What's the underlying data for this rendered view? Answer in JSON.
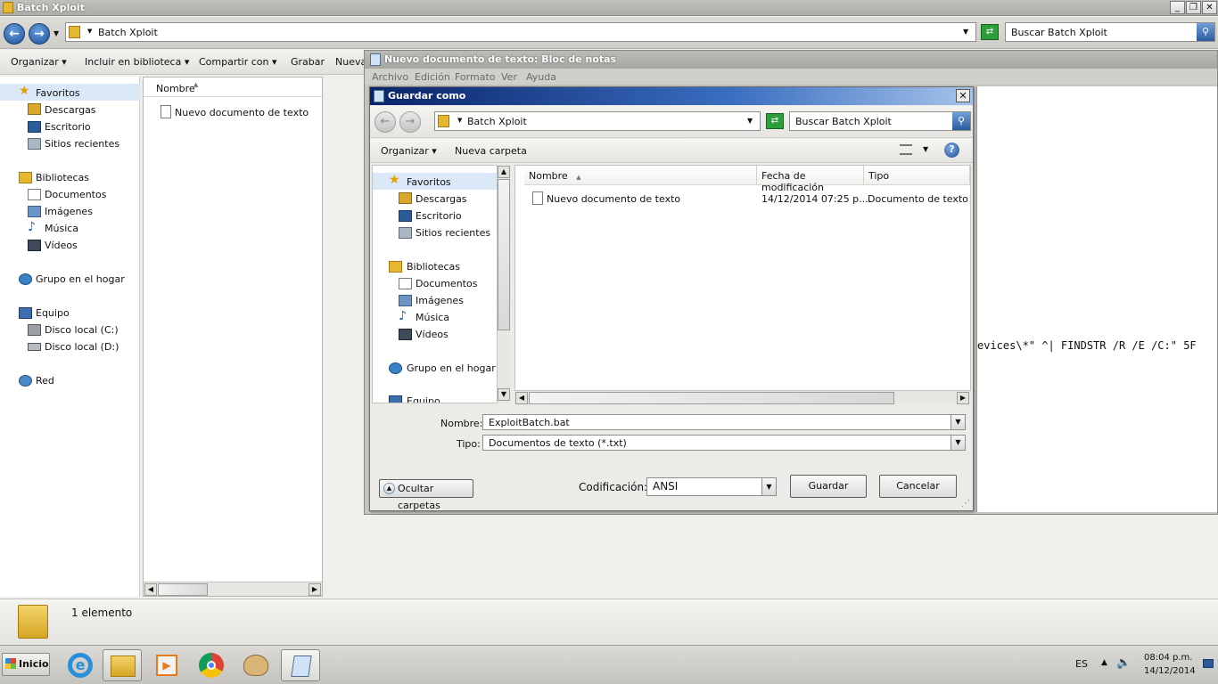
{
  "explorer": {
    "title": "Batch Xploit",
    "address": "Batch Xploit",
    "search_placeholder": "Buscar Batch Xploit",
    "toolbar": [
      "Organizar",
      "Incluir en biblioteca",
      "Compartir con",
      "Grabar",
      "Nueva"
    ],
    "nav": {
      "favoritos": "Favoritos",
      "descargas": "Descargas",
      "escritorio": "Escritorio",
      "sitios": "Sitios recientes",
      "bibliotecas": "Bibliotecas",
      "documentos": "Documentos",
      "imagenes": "Imágenes",
      "musica": "Música",
      "videos": "Vídeos",
      "grupo": "Grupo en el hogar",
      "equipo": "Equipo",
      "disco_c": "Disco local (C:)",
      "disco_d": "Disco local (D:)",
      "red": "Red"
    },
    "list_header": "Nombre",
    "files": [
      "Nuevo documento de texto"
    ],
    "status": "1 elemento"
  },
  "notepad": {
    "title": "Nuevo documento de texto: Bloc de notas",
    "menu": [
      "Archivo",
      "Edición",
      "Formato",
      "Ver",
      "Ayuda"
    ],
    "visible_text": "evices\\*\" ^| FINDSTR /R /E /C:\" 5F"
  },
  "dialog": {
    "title": "Guardar como",
    "address": "Batch Xploit",
    "search_placeholder": "Buscar Batch Xploit",
    "organizar": "Organizar",
    "nueva_carpeta": "Nueva carpeta",
    "nav": {
      "favoritos": "Favoritos",
      "descargas": "Descargas",
      "escritorio": "Escritorio",
      "sitios": "Sitios recientes",
      "bibliotecas": "Bibliotecas",
      "documentos": "Documentos",
      "imagenes": "Imágenes",
      "musica": "Música",
      "videos": "Vídeos",
      "grupo": "Grupo en el hogar",
      "equipo": "Equipo"
    },
    "columns": [
      "Nombre",
      "Fecha de modificación",
      "Tipo"
    ],
    "rows": [
      {
        "name": "Nuevo documento de texto",
        "date": "14/12/2014 07:25 p....",
        "type": "Documento de texto"
      }
    ],
    "nombre_label": "Nombre:",
    "nombre_value": "ExploitBatch.bat",
    "tipo_label": "Tipo:",
    "tipo_value": "Documentos de texto (*.txt)",
    "ocultar": "Ocultar carpetas",
    "codificacion_label": "Codificación:",
    "codificacion_value": "ANSI",
    "guardar": "Guardar",
    "cancelar": "Cancelar"
  },
  "taskbar": {
    "start": "Inicio",
    "lang": "ES",
    "time": "08:04 p.m.",
    "date": "14/12/2014"
  }
}
